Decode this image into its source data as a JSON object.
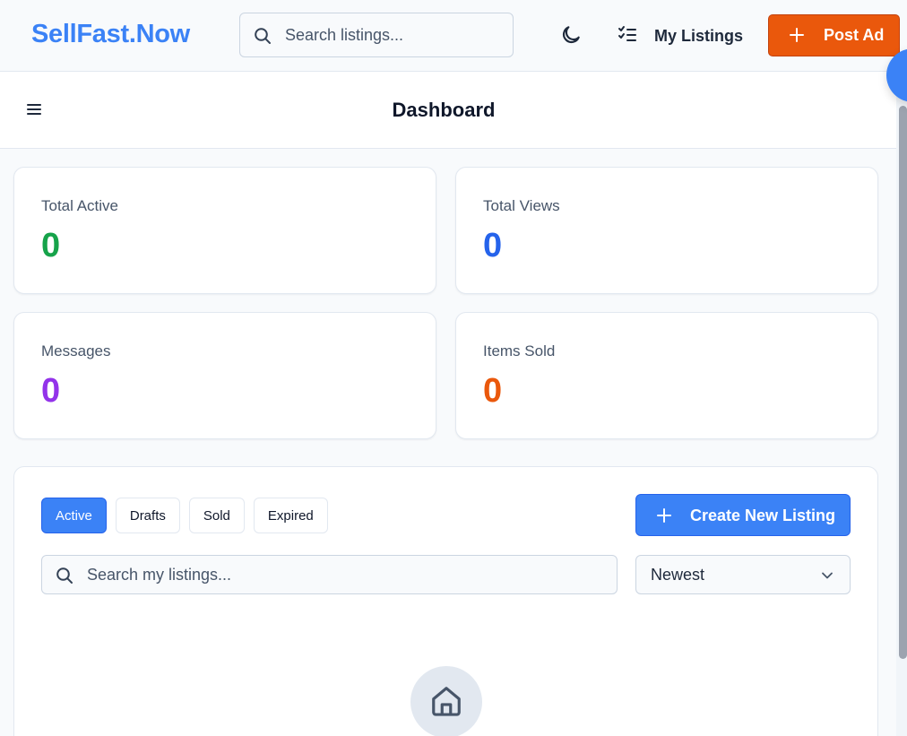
{
  "header": {
    "brand": "SellFast.Now",
    "search_placeholder": "Search listings...",
    "my_listings_label": "My Listings",
    "post_ad_label": "Post Ad"
  },
  "dashboard": {
    "title": "Dashboard"
  },
  "stats": [
    {
      "label": "Total Active",
      "value": "0",
      "color": "#16a34a"
    },
    {
      "label": "Total Views",
      "value": "0",
      "color": "#2563eb"
    },
    {
      "label": "Messages",
      "value": "0",
      "color": "#9333ea"
    },
    {
      "label": "Items Sold",
      "value": "0",
      "color": "#ea580c"
    }
  ],
  "listings": {
    "tabs": [
      {
        "label": "Active",
        "active": true
      },
      {
        "label": "Drafts",
        "active": false
      },
      {
        "label": "Sold",
        "active": false
      },
      {
        "label": "Expired",
        "active": false
      }
    ],
    "create_label": "Create New Listing",
    "search_placeholder": "Search my listings...",
    "sort_value": "Newest",
    "empty_icon": "home-icon"
  },
  "colors": {
    "accent": "#3b82f6",
    "cta": "#ea580c"
  }
}
